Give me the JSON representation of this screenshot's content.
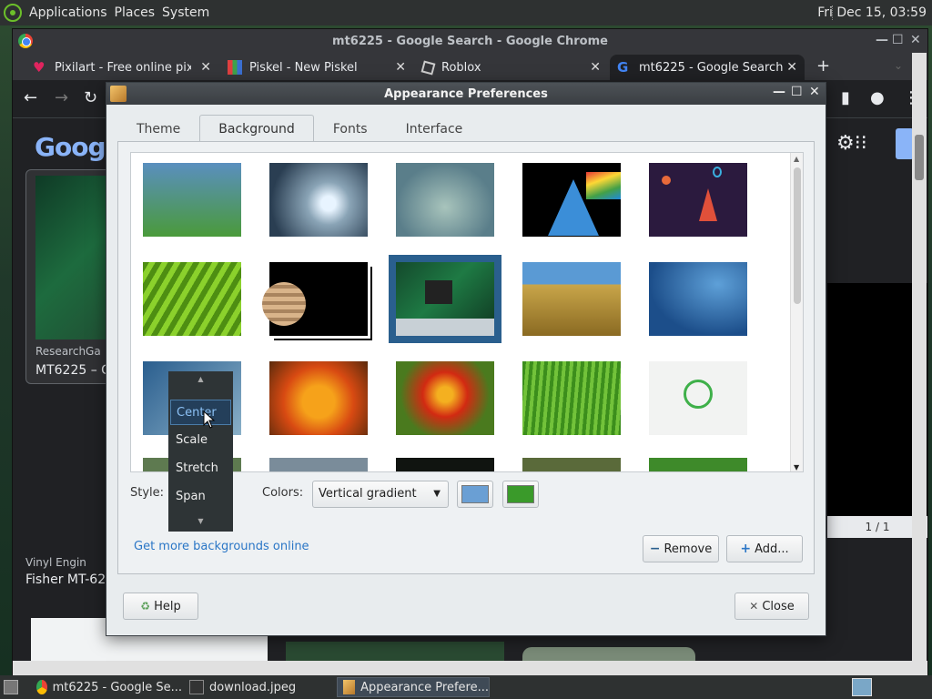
{
  "top_panel": {
    "menus": [
      "Applications",
      "Places",
      "System"
    ],
    "clock": "Fri Dec 15, 03:59"
  },
  "chrome": {
    "title": "mt6225 - Google Search - Google Chrome",
    "tabs": [
      {
        "title": "Pixilart - Free online pixel",
        "icon": "heart-icon"
      },
      {
        "title": "Piskel - New Piskel",
        "icon": "piskel-icon"
      },
      {
        "title": "Roblox",
        "icon": "roblox-icon"
      },
      {
        "title": "mt6225 - Google Search",
        "icon": "google-icon"
      }
    ],
    "page": {
      "logo": "Goog",
      "result1": {
        "source": "ResearchGa",
        "title": "MT6225 – G"
      },
      "result2": {
        "source": "Vinyl Engin",
        "title": "Fisher MT-62"
      },
      "side_counter": "1 / 1"
    }
  },
  "dialog": {
    "title": "Appearance Preferences",
    "tabs": [
      "Theme",
      "Background",
      "Fonts",
      "Interface"
    ],
    "selected_tab": "Background",
    "wallpapers": [
      "blue-green gradient",
      "water droplet",
      "blue-green blur",
      "arch logo prism",
      "space rocket",
      "green leaf",
      "jupiter",
      "circuit board",
      "wheat field",
      "blue water",
      "blue cloud",
      "orange flower",
      "red flower",
      "green grass",
      "green spiral logo"
    ],
    "style_label": "Style:",
    "style_options": [
      "Center",
      "Scale",
      "Stretch",
      "Span"
    ],
    "style_hovered": "Center",
    "colors_label": "Colors:",
    "colors_value": "Vertical gradient",
    "color1": "#6a9fd4",
    "color2": "#3a9a2a",
    "get_more_link": "Get more backgrounds online",
    "remove_label": "Remove",
    "add_label": "Add...",
    "help_label": "Help",
    "close_label": "Close"
  },
  "taskbar": {
    "items": [
      "mt6225 - Google Se...",
      "download.jpeg",
      "Appearance Prefere..."
    ]
  }
}
